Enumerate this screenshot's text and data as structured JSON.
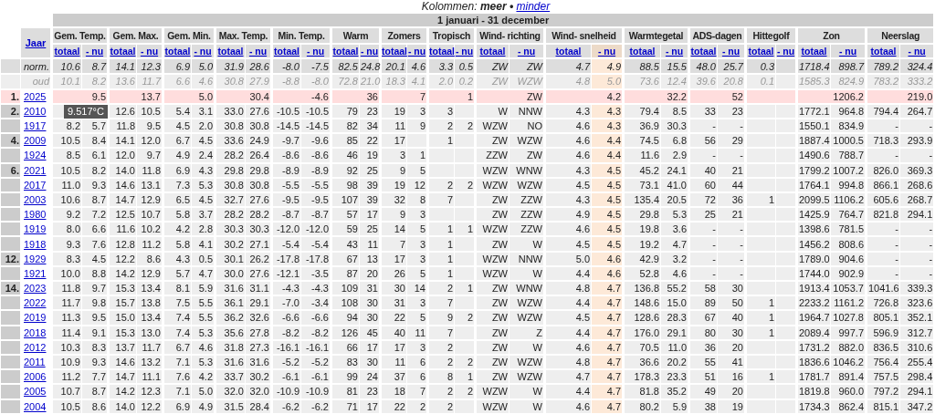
{
  "column_toggle": {
    "label": "Kolommen:",
    "current": "meer",
    "separator": "•",
    "link": "minder"
  },
  "period": "1 januari - 31 december",
  "year_header": "Jaar",
  "groups": [
    {
      "name": "Gem. Temp.",
      "sub": [
        {
          "label": "totaal",
          "selected": false
        },
        {
          "label": "- nu",
          "selected": false
        }
      ]
    },
    {
      "name": "Gem. Max.",
      "sub": [
        {
          "label": "totaal",
          "selected": false
        },
        {
          "label": "- nu",
          "selected": false
        }
      ]
    },
    {
      "name": "Gem. Min.",
      "sub": [
        {
          "label": "totaal",
          "selected": false
        },
        {
          "label": "- nu",
          "selected": false
        }
      ]
    },
    {
      "name": "Max. Temp.",
      "sub": [
        {
          "label": "totaal",
          "selected": false
        },
        {
          "label": "- nu",
          "selected": false
        }
      ]
    },
    {
      "name": "Min. Temp.",
      "sub": [
        {
          "label": "totaal",
          "selected": false
        },
        {
          "label": "- nu",
          "selected": false
        }
      ]
    },
    {
      "name": "Warm",
      "sub": [
        {
          "label": "totaal",
          "selected": false
        },
        {
          "label": "- nu",
          "selected": false
        }
      ]
    },
    {
      "name": "Zomers",
      "sub": [
        {
          "label": "totaal",
          "selected": false
        },
        {
          "label": "- nu",
          "selected": false
        }
      ]
    },
    {
      "name": "Tropisch",
      "sub": [
        {
          "label": "totaal",
          "selected": false
        },
        {
          "label": "- nu",
          "selected": false
        }
      ]
    },
    {
      "name": "Wind- richting",
      "sub": [
        {
          "label": "totaal",
          "selected": false
        },
        {
          "label": "- nu",
          "selected": false
        }
      ]
    },
    {
      "name": "Wind- snelheid",
      "sub": [
        {
          "label": "totaal",
          "selected": false
        },
        {
          "label": "- nu",
          "selected": true
        }
      ]
    },
    {
      "name": "Warmtegetal",
      "sub": [
        {
          "label": "totaal",
          "selected": false
        },
        {
          "label": "- nu",
          "selected": false
        }
      ]
    },
    {
      "name": "ADS-dagen",
      "sub": [
        {
          "label": "totaal",
          "selected": false
        },
        {
          "label": "- nu",
          "selected": false
        }
      ]
    },
    {
      "name": "Hittegolf",
      "sub": [
        {
          "label": "totaal",
          "selected": false
        },
        {
          "label": "- nu",
          "selected": false
        }
      ]
    },
    {
      "name": "Zon",
      "sub": [
        {
          "label": "totaal",
          "selected": false
        },
        {
          "label": "- nu",
          "selected": false
        }
      ]
    },
    {
      "name": "Neerslag",
      "sub": [
        {
          "label": "totaal",
          "selected": false
        },
        {
          "label": "- nu",
          "selected": false
        }
      ]
    }
  ],
  "reference_rows": [
    {
      "label": "norm.",
      "kind": "norm",
      "cells": [
        "10.6",
        "8.7",
        "14.1",
        "12.3",
        "6.9",
        "5.0",
        "31.9",
        "28.6",
        "-8.0",
        "-7.5",
        "82.5",
        "24.8",
        "20.1",
        "4.6",
        "3.3",
        "0.5",
        "ZW",
        "ZW",
        "4.7",
        "4.9",
        "88.5",
        "15.5",
        "48.0",
        "25.7",
        "0.3",
        null,
        "1718.4",
        "898.7",
        "789.2",
        "324.4"
      ]
    },
    {
      "label": "oud",
      "kind": "old",
      "cells": [
        "10.1",
        "8.2",
        "13.6",
        "11.7",
        "6.6",
        "4.6",
        "30.8",
        "27.9",
        "-8.8",
        "-8.0",
        "72.8",
        "21.0",
        "18.3",
        "4.1",
        "2.0",
        "0.2",
        "ZW",
        "WZW",
        "4.8",
        "5.0",
        "73.6",
        "12.4",
        "39.6",
        "20.8",
        "0.1",
        null,
        "1585.3",
        "824.9",
        "783.2",
        "333.2"
      ]
    }
  ],
  "current_row": {
    "rank": "1.",
    "year": "2025",
    "cells": [
      "9.5",
      "13.7",
      "5.0",
      "30.4",
      "-4.6",
      "36",
      "7",
      "1",
      "ZW",
      "4.2",
      "32.2",
      "52",
      null,
      "1206.2",
      "219.0"
    ]
  },
  "rows": [
    {
      "rank": "2.",
      "year": "2010",
      "cells": [
        null,
        null,
        "12.6",
        "10.5",
        "5.4",
        "3.1",
        "33.0",
        "27.6",
        "-10.5",
        "-10.5",
        "79",
        "23",
        "19",
        "3",
        "3",
        null,
        "W",
        "NNW",
        "4.3",
        "4.3",
        "79.4",
        "8.5",
        "33",
        "23",
        null,
        null,
        "1772.1",
        "964.8",
        "794.4",
        "264.7"
      ]
    },
    {
      "year": "1917",
      "cells": [
        "8.2",
        "5.7",
        "11.8",
        "9.5",
        "4.5",
        "2.0",
        "30.8",
        "30.8",
        "-14.5",
        "-14.5",
        "82",
        "34",
        "11",
        "9",
        "2",
        "2",
        "WZW",
        "NO",
        "4.6",
        "4.3",
        "36.9",
        "30.3",
        "-",
        "-",
        null,
        null,
        "1550.1",
        "834.9",
        "-",
        "-"
      ]
    },
    {
      "rank": "4.",
      "year": "2009",
      "cells": [
        "10.5",
        "8.4",
        "14.1",
        "12.0",
        "6.7",
        "4.5",
        "33.6",
        "24.9",
        "-9.7",
        "-9.6",
        "85",
        "22",
        "17",
        null,
        "1",
        null,
        "ZW",
        "WZW",
        "4.6",
        "4.4",
        "74.5",
        "6.8",
        "56",
        "29",
        null,
        null,
        "1887.4",
        "1000.5",
        "718.3",
        "293.9"
      ]
    },
    {
      "year": "1924",
      "cells": [
        "8.5",
        "6.1",
        "12.0",
        "9.7",
        "4.9",
        "2.4",
        "28.2",
        "26.4",
        "-8.6",
        "-8.6",
        "46",
        "19",
        "3",
        "1",
        null,
        null,
        "ZZW",
        "ZW",
        "4.6",
        "4.4",
        "11.6",
        "2.9",
        "-",
        "-",
        null,
        null,
        "1490.6",
        "788.7",
        "-",
        "-"
      ]
    },
    {
      "rank": "6.",
      "year": "2021",
      "cells": [
        "10.5",
        "8.2",
        "14.0",
        "11.8",
        "6.9",
        "4.3",
        "29.8",
        "29.8",
        "-8.9",
        "-8.9",
        "92",
        "25",
        "9",
        "5",
        null,
        null,
        "WZW",
        "WNW",
        "4.3",
        "4.5",
        "45.2",
        "24.1",
        "40",
        "21",
        null,
        null,
        "1799.2",
        "1007.2",
        "826.0",
        "369.3"
      ]
    },
    {
      "year": "2017",
      "cells": [
        "11.0",
        "9.3",
        "14.6",
        "13.1",
        "7.3",
        "5.3",
        "30.8",
        "30.8",
        "-5.5",
        "-5.5",
        "98",
        "39",
        "19",
        "12",
        "2",
        "2",
        "WZW",
        "WZW",
        "4.5",
        "4.5",
        "73.1",
        "41.0",
        "60",
        "44",
        null,
        null,
        "1764.1",
        "994.8",
        "866.1",
        "268.6"
      ]
    },
    {
      "year": "2003",
      "cells": [
        "10.6",
        "8.7",
        "14.7",
        "12.9",
        "6.5",
        "4.5",
        "32.7",
        "27.6",
        "-9.5",
        "-9.5",
        "107",
        "39",
        "32",
        "8",
        "7",
        null,
        "ZW",
        "ZZW",
        "4.3",
        "4.5",
        "135.4",
        "20.5",
        "72",
        "36",
        "1",
        null,
        "2099.5",
        "1106.2",
        "605.6",
        "268.7"
      ]
    },
    {
      "year": "1980",
      "cells": [
        "9.2",
        "7.2",
        "12.5",
        "10.7",
        "5.8",
        "3.7",
        "28.2",
        "28.2",
        "-8.7",
        "-8.7",
        "57",
        "17",
        "9",
        "3",
        null,
        null,
        "ZW",
        "ZZW",
        "4.9",
        "4.5",
        "29.8",
        "5.3",
        "25",
        "21",
        null,
        null,
        "1425.9",
        "764.7",
        "821.8",
        "294.1"
      ]
    },
    {
      "year": "1919",
      "cells": [
        "8.0",
        "6.6",
        "11.6",
        "10.2",
        "4.2",
        "2.8",
        "30.3",
        "30.3",
        "-12.0",
        "-12.0",
        "59",
        "25",
        "14",
        "5",
        "1",
        "1",
        "WZW",
        "ZZW",
        "4.6",
        "4.5",
        "19.8",
        "3.6",
        "-",
        "-",
        null,
        null,
        "1398.6",
        "781.5",
        "-",
        "-"
      ]
    },
    {
      "year": "1918",
      "cells": [
        "9.3",
        "7.6",
        "12.8",
        "11.2",
        "5.8",
        "4.1",
        "30.2",
        "27.1",
        "-5.4",
        "-5.4",
        "43",
        "11",
        "7",
        "3",
        "1",
        null,
        "ZW",
        "W",
        "4.5",
        "4.5",
        "19.2",
        "4.7",
        "-",
        "-",
        null,
        null,
        "1456.2",
        "808.6",
        "-",
        "-"
      ]
    },
    {
      "rank": "12.",
      "year": "1929",
      "cells": [
        "8.3",
        "4.5",
        "12.2",
        "8.6",
        "4.3",
        "0.5",
        "30.1",
        "26.2",
        "-17.8",
        "-17.8",
        "67",
        "13",
        "17",
        "3",
        "1",
        null,
        "WZW",
        "NNW",
        "5.0",
        "4.6",
        "42.9",
        "3.2",
        "-",
        "-",
        null,
        null,
        "1789.0",
        "904.6",
        "-",
        "-"
      ]
    },
    {
      "year": "1921",
      "cells": [
        "10.0",
        "8.8",
        "14.2",
        "12.9",
        "5.7",
        "4.7",
        "30.0",
        "27.6",
        "-12.1",
        "-3.5",
        "87",
        "20",
        "26",
        "5",
        "1",
        null,
        "WZW",
        "W",
        "4.4",
        "4.6",
        "52.8",
        "4.6",
        "-",
        "-",
        null,
        null,
        "1744.0",
        "902.9",
        "-",
        "-"
      ]
    },
    {
      "rank": "14.",
      "year": "2023",
      "cells": [
        "11.8",
        "9.7",
        "15.3",
        "13.4",
        "8.1",
        "5.9",
        "31.6",
        "31.1",
        "-4.3",
        "-4.3",
        "109",
        "31",
        "30",
        "14",
        "2",
        "1",
        "ZW",
        "WNW",
        "4.8",
        "4.7",
        "136.8",
        "55.2",
        "58",
        "30",
        null,
        null,
        "1913.4",
        "1053.7",
        "1041.6",
        "339.3"
      ]
    },
    {
      "year": "2022",
      "cells": [
        "11.7",
        "9.8",
        "15.7",
        "13.8",
        "7.5",
        "5.5",
        "36.1",
        "29.1",
        "-7.0",
        "-3.4",
        "108",
        "30",
        "31",
        "3",
        "7",
        null,
        "ZW",
        "WZW",
        "4.4",
        "4.7",
        "148.6",
        "15.0",
        "89",
        "50",
        "1",
        null,
        "2233.2",
        "1161.2",
        "726.8",
        "323.6"
      ]
    },
    {
      "year": "2019",
      "cells": [
        "11.3",
        "9.5",
        "15.0",
        "13.4",
        "7.4",
        "5.5",
        "36.2",
        "32.6",
        "-6.6",
        "-6.6",
        "94",
        "30",
        "22",
        "5",
        "9",
        "2",
        "ZW",
        "WZW",
        "4.5",
        "4.7",
        "128.6",
        "28.3",
        "67",
        "40",
        "1",
        null,
        "1964.7",
        "1027.8",
        "805.1",
        "352.1"
      ]
    },
    {
      "year": "2018",
      "cells": [
        "11.4",
        "9.1",
        "15.3",
        "13.0",
        "7.4",
        "5.3",
        "35.6",
        "27.8",
        "-8.2",
        "-8.2",
        "126",
        "45",
        "40",
        "11",
        "7",
        null,
        "ZW",
        "Z",
        "4.4",
        "4.7",
        "176.0",
        "29.1",
        "80",
        "30",
        "1",
        null,
        "2089.4",
        "997.7",
        "596.9",
        "312.7"
      ]
    },
    {
      "year": "2012",
      "cells": [
        "10.3",
        "8.3",
        "13.7",
        "11.7",
        "6.7",
        "4.6",
        "31.8",
        "27.3",
        "-16.1",
        "-16.1",
        "66",
        "17",
        "17",
        "3",
        "2",
        null,
        "ZW",
        "W",
        "4.6",
        "4.7",
        "70.5",
        "11.0",
        "36",
        "20",
        null,
        null,
        "1731.2",
        "882.0",
        "836.5",
        "310.6"
      ]
    },
    {
      "year": "2011",
      "cells": [
        "10.9",
        "9.3",
        "14.6",
        "13.2",
        "7.1",
        "5.3",
        "31.6",
        "31.6",
        "-5.2",
        "-5.2",
        "83",
        "30",
        "11",
        "6",
        "2",
        "2",
        "ZW",
        "WZW",
        "4.8",
        "4.7",
        "36.6",
        "20.2",
        "55",
        "41",
        null,
        null,
        "1836.6",
        "1046.2",
        "756.4",
        "255.4"
      ]
    },
    {
      "year": "2006",
      "cells": [
        "11.2",
        "7.7",
        "14.7",
        "11.1",
        "7.6",
        "4.2",
        "33.7",
        "30.2",
        "-6.1",
        "-6.1",
        "99",
        "24",
        "37",
        "6",
        "8",
        "1",
        "ZW",
        "WZW",
        "4.7",
        "4.7",
        "178.3",
        "23.3",
        "51",
        "16",
        "1",
        null,
        "1781.7",
        "891.4",
        "757.5",
        "298.4"
      ]
    },
    {
      "year": "2005",
      "cells": [
        "10.7",
        "8.7",
        "14.2",
        "12.3",
        "7.1",
        "5.0",
        "32.0",
        "32.0",
        "-10.9",
        "-10.9",
        "81",
        "23",
        "18",
        "7",
        "2",
        "2",
        "WZW",
        "W",
        "4.4",
        "4.7",
        "81.8",
        "35.2",
        "49",
        "20",
        null,
        null,
        "1819.8",
        "960.0",
        "797.2",
        "294.1"
      ]
    },
    {
      "year": "2004",
      "cells": [
        "10.5",
        "8.6",
        "14.0",
        "12.2",
        "6.9",
        "4.9",
        "31.5",
        "28.4",
        "-6.2",
        "-6.2",
        "71",
        "17",
        "22",
        "2",
        "2",
        null,
        "WZW",
        "W",
        "4.6",
        "4.7",
        "80.2",
        "5.9",
        "38",
        "19",
        null,
        null,
        "1734.3",
        "862.4",
        "815.1",
        "347.2"
      ]
    }
  ],
  "tooltip": {
    "text": "9.517°C"
  }
}
